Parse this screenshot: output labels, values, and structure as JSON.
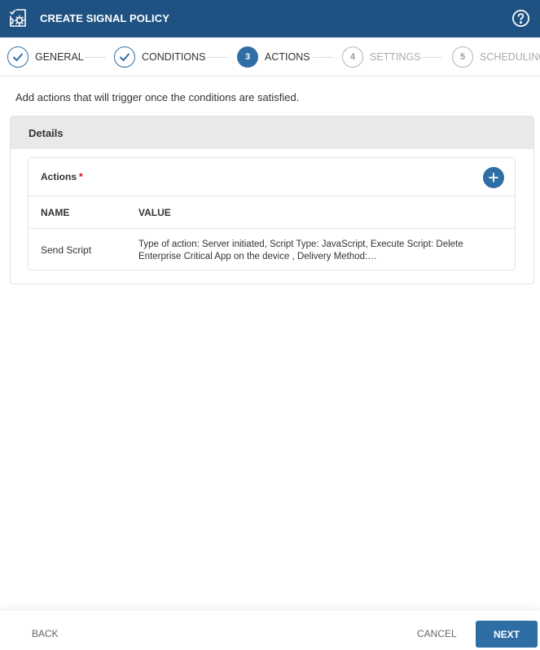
{
  "header": {
    "title": "CREATE SIGNAL POLICY",
    "logo_icon": "signal-policy-gear-icon",
    "help_icon": "question-circle-icon"
  },
  "stepper": {
    "steps": [
      {
        "number": "1",
        "label": "GENERAL",
        "state": "done"
      },
      {
        "number": "2",
        "label": "CONDITIONS",
        "state": "done"
      },
      {
        "number": "3",
        "label": "ACTIONS",
        "state": "active"
      },
      {
        "number": "4",
        "label": "SETTINGS",
        "state": "pending"
      },
      {
        "number": "5",
        "label": "SCHEDULING",
        "state": "pending"
      }
    ]
  },
  "main": {
    "intro": "Add actions that will trigger once the conditions are satisfied.",
    "details": {
      "title": "Details",
      "actions": {
        "title": "Actions",
        "required_mark": "*",
        "add_icon": "plus-icon",
        "columns": [
          "NAME",
          "VALUE"
        ],
        "rows": [
          {
            "name": "Send Script",
            "value": "Type of action: Server initiated, Script Type: JavaScript, Execute Script: Delete Enterprise Critical App on the device , Delivery Method:…"
          }
        ]
      }
    }
  },
  "footer": {
    "back_label": "BACK",
    "cancel_label": "CANCEL",
    "next_label": "NEXT"
  },
  "colors": {
    "header_bg": "#1f5283",
    "accent": "#2f6ea5",
    "required": "#d0021b"
  }
}
